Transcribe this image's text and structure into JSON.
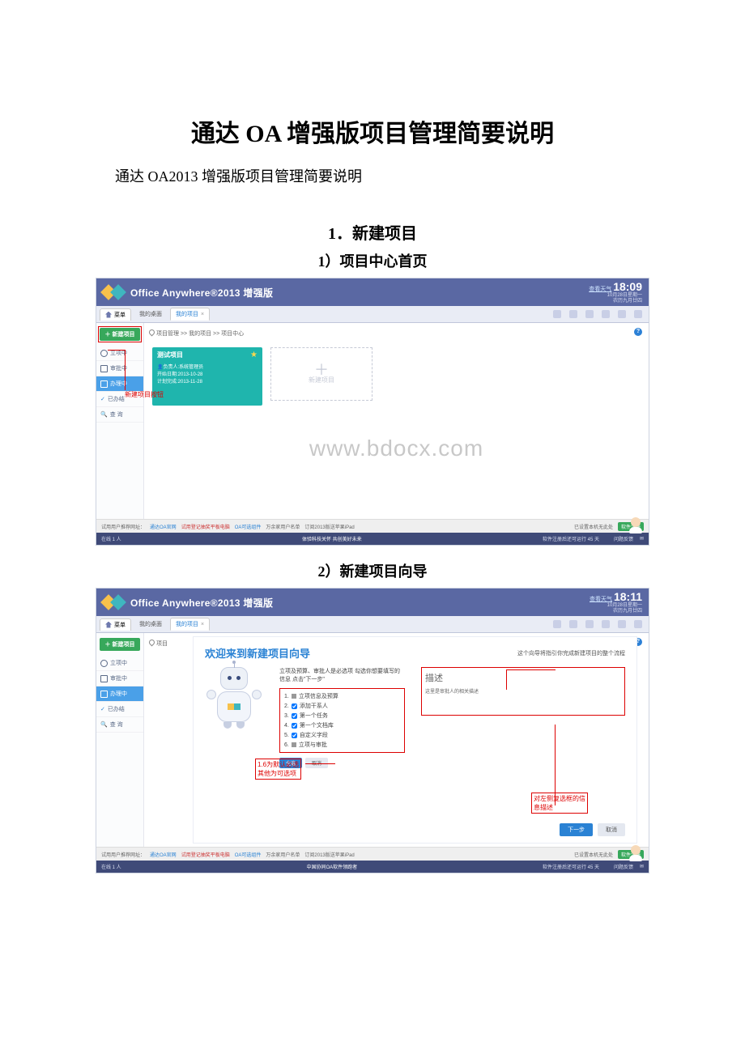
{
  "doc": {
    "title": "通达 OA 增强版项目管理简要说明",
    "subtitle": "通达 OA2013 增强版项目管理简要说明",
    "section1": "1．新建项目",
    "step1_1": "1）项目中心首页",
    "step1_2": "2）新建项目向导",
    "watermark": "www.bdocx.com"
  },
  "shot1": {
    "brand": "Office Anywhere®2013 增强版",
    "weather": "查看天气",
    "clock": "18:09",
    "date1": "10月28日星期一",
    "date2": "农历九月廿四",
    "menu": "菜单",
    "tab_desktop": "我的桌面",
    "tab_active": "我的项目",
    "newbtn": "＋ 新建项目",
    "side": {
      "li1": "立项中",
      "li2": "审批中",
      "li3": "办理中",
      "li4": "已办结",
      "li5": "查  询"
    },
    "crumb": "项目管理 >> 我的项目 >> 项目中心",
    "card": {
      "title": "测试项目",
      "owner_label": "负责人:",
      "owner": "系统管理员",
      "start_label": "开始日期:",
      "start": "2013-10-28",
      "end_label": "计划完成:",
      "end": "2013-11-28"
    },
    "add_card": "新建项目",
    "annot_newbtn": "新建项目按钮",
    "linkbar": {
      "l1": "试用用户推荐网址：",
      "l2": "通达OA官网",
      "l3": "试用登记抽奖平板电脑",
      "l4": "OA可选组件",
      "l5": "万余家用户名单",
      "l6": "订阅2013版送苹果iPad",
      "right1": "已设置本机无此处",
      "reg": "软件注册"
    },
    "status": {
      "left": "在线 1 人",
      "center": "体验科技关怀 共创美好未来",
      "right1": "软件注册后还可运行 45 天",
      "right2": "问题反馈"
    }
  },
  "shot2": {
    "clock": "18:11",
    "crumb_short": "项目",
    "wizard": {
      "title": "欢迎来到新建项目向导",
      "desc": "这个向导将指引你完成新建项目的整个流程",
      "para": "立项及预算、审批人是必选项 勾选你想要填写的信息 点击\"下一步\"",
      "items": {
        "i1": "立项信息及预算",
        "i2": "添加干系人",
        "i3": "第一个任务",
        "i4": "第一个文档库",
        "i5": "自定义字段",
        "i6": "立项与审批"
      },
      "selectall": "全选",
      "clear": "取消",
      "desc_title": "描述",
      "desc_body": "这里是审批人的相关描述",
      "next": "下一步",
      "cancel": "取消",
      "annot_mid": "1.6为默认必选\n其他为可选项",
      "annot_right": "对左侧复选框的信息描述"
    },
    "status_center": "中国协同OA软件领跑者"
  }
}
